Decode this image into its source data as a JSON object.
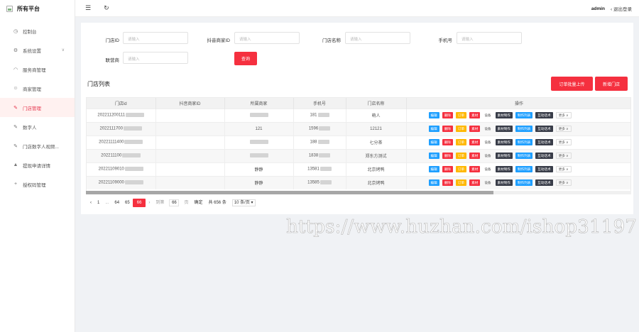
{
  "brand": {
    "title": "所有平台"
  },
  "sidebar": {
    "items": [
      {
        "label": "控制台",
        "icon": "dashboard-icon"
      },
      {
        "label": "系统设置",
        "icon": "gear-icon"
      },
      {
        "label": "服务商管理",
        "icon": "wifi-icon"
      },
      {
        "label": "商家管理",
        "icon": "smile-icon"
      },
      {
        "label": "门店管理",
        "icon": "edit-icon"
      },
      {
        "label": "数字人",
        "icon": "edit-icon"
      },
      {
        "label": "门店数字人视频...",
        "icon": "edit-icon"
      },
      {
        "label": "提现申请详情",
        "icon": "cap-icon"
      },
      {
        "label": "授权码管理",
        "icon": "plus-icon"
      }
    ]
  },
  "header": {
    "user": "admin",
    "logout": "退出登录"
  },
  "filters": {
    "store_id": {
      "label": "门店ID",
      "placeholder": "请输入"
    },
    "douyin_id": {
      "label": "抖音商家ID",
      "placeholder": "请输入"
    },
    "store_name": {
      "label": "门店名称",
      "placeholder": "请输入"
    },
    "phone": {
      "label": "手机号",
      "placeholder": "请输入"
    },
    "operator": {
      "label": "联营商",
      "placeholder": "请输入"
    },
    "query_button": "查询"
  },
  "list": {
    "title": "门店列表",
    "upload_button": "订单批量上传",
    "add_button": "新增门店"
  },
  "table": {
    "columns": [
      "门店id",
      "抖音商家ID",
      "所属商家",
      "手机号",
      "门店名称",
      "操作"
    ],
    "rows": [
      {
        "id": "202211200111",
        "douyin": "",
        "merchant": "",
        "phone": "181",
        "name": "萌人"
      },
      {
        "id": "2022111700",
        "douyin": "",
        "merchant": "121",
        "phone": "1596",
        "name": "12121"
      },
      {
        "id": "20221111400",
        "douyin": "",
        "merchant": "",
        "phone": "188",
        "name": "七分茶"
      },
      {
        "id": "202211100",
        "douyin": "",
        "merchant": "",
        "phone": "1838",
        "name": "郑东方测试"
      },
      {
        "id": "20221109010",
        "douyin": "",
        "merchant": "静静",
        "phone": "13581",
        "name": "北京烤鸭"
      },
      {
        "id": "20221109000",
        "douyin": "",
        "merchant": "静静",
        "phone": "13585",
        "name": "北京烤鸭"
      }
    ],
    "actions": {
      "edit": "编辑",
      "delete": "删除",
      "order": "订单",
      "material": "素材",
      "device": "设备",
      "make": "素材制作",
      "make_list": "制作列表",
      "script": "互动话术",
      "more": "更多"
    }
  },
  "pagination": {
    "p1": "1",
    "ellipsis": "...",
    "p64": "64",
    "p65": "65",
    "current": "66",
    "goto": "到第",
    "page_value": "66",
    "page_unit": "页",
    "confirm": "确定",
    "total": "共 656 条",
    "page_size": "10 条/页"
  },
  "watermark": "https://www.huzhan.com/ishop31197",
  "colors": {
    "accent": "#f5303f",
    "blue": "#1e9fff",
    "orange": "#ffb800",
    "dark": "#393d49"
  }
}
